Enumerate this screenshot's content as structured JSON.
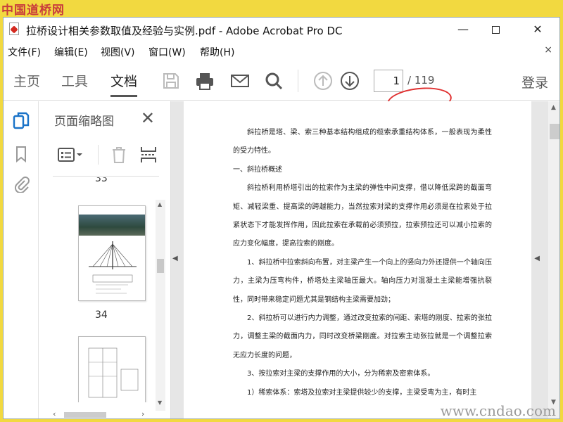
{
  "watermark": {
    "top": "中国道桥网",
    "bottom": "www.cndao.com"
  },
  "window": {
    "title": "拉桥设计相关参数取值及经验与实例.pdf - Adobe Acrobat Pro DC"
  },
  "menu": {
    "items": [
      "文件(F)",
      "编辑(E)",
      "视图(V)",
      "窗口(W)",
      "帮助(H)"
    ],
    "close": "×"
  },
  "toolbar": {
    "tabs": [
      "主页",
      "工具",
      "文档"
    ],
    "active_tab": "文档",
    "page_current": "1",
    "page_total": "/ 119",
    "login": "登录",
    "icons": [
      "save-icon",
      "print-icon",
      "email-icon",
      "search-icon",
      "page-up-icon",
      "page-down-icon"
    ]
  },
  "sidebar": {
    "panel_title": "页面缩略图",
    "thumbnails": [
      {
        "label": "33"
      },
      {
        "label": "34"
      }
    ]
  },
  "document": {
    "paragraphs": [
      {
        "text": "斜拉桥是塔、梁、索三种基本结构组成的缆索承重结构体系，一般表现为柔性的受力特性。",
        "indent": true
      },
      {
        "text": "一、斜拉桥概述",
        "indent": false
      },
      {
        "text": "斜拉桥利用桥塔引出的拉索作为主梁的弹性中间支撑，借以降低梁跨的截面弯矩、减轻梁重、提高梁的跨越能力，当然拉索对梁的支撑作用必须是在拉索处于拉紧状态下才能发挥作用，因此拉索在承载前必须预拉，拉索预拉还可以减小拉索的应力变化幅度，提高拉索的刚度。",
        "indent": true
      },
      {
        "text": "1、斜拉桥中拉索斜向布置，对主梁产生一个向上的竖向力外还提供一个轴向压力，主梁为压弯构件，桥塔处主梁轴压最大。轴向压力对混凝土主梁能增强抗裂性，同时带来稳定问题尤其是钢结构主梁需要加劲；",
        "indent": true
      },
      {
        "text": "2、斜拉桥可以进行内力调整，通过改变拉索的间距、索塔的刚度、拉索的张拉力，调整主梁的截面内力，同时改变桥梁刚度。对拉索主动张拉就是一个调整拉索无应力长度的问题，",
        "indent": true
      },
      {
        "text": "3、按拉索对主梁的支撑作用的大小，分为稀索及密索体系。",
        "indent": true
      },
      {
        "text": "1）稀索体系：索塔及拉索对主梁提供较少的支撑，主梁受弯为主，有时主",
        "indent": true
      }
    ]
  },
  "colors": {
    "background": "#f2d940",
    "highlight": "#e03030",
    "accent": "#1a73c8"
  }
}
